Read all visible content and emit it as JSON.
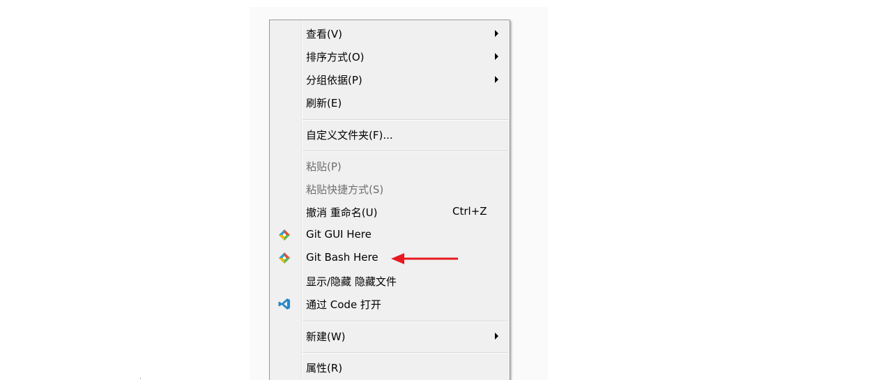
{
  "menu": {
    "items": [
      {
        "label": "查看(V)"
      },
      {
        "label": "排序方式(O)"
      },
      {
        "label": "分组依据(P)"
      },
      {
        "label": "刷新(E)"
      },
      {
        "label": "自定义文件夹(F)..."
      },
      {
        "label": "粘贴(P)",
        "disabled": true
      },
      {
        "label": "粘贴快捷方式(S)",
        "disabled": true
      },
      {
        "label": "撤消 重命名(U)",
        "shortcut": "Ctrl+Z"
      },
      {
        "label": "Git GUI Here",
        "icon": "git-icon"
      },
      {
        "label": "Git Bash Here",
        "icon": "git-icon"
      },
      {
        "label": "显示/隐藏 隐藏文件"
      },
      {
        "label": "通过 Code 打开",
        "icon": "vscode-icon"
      },
      {
        "label": "新建(W)"
      },
      {
        "label": "属性(R)"
      }
    ]
  },
  "annotation": {
    "type": "red-arrow",
    "color": "#e8191f",
    "target": "Git Bash Here"
  },
  "colors": {
    "menu_bg": "#f0f0f0",
    "border": "#979797",
    "disabled_text": "#6d6d6d",
    "vscode_blue": "#2489ca"
  }
}
